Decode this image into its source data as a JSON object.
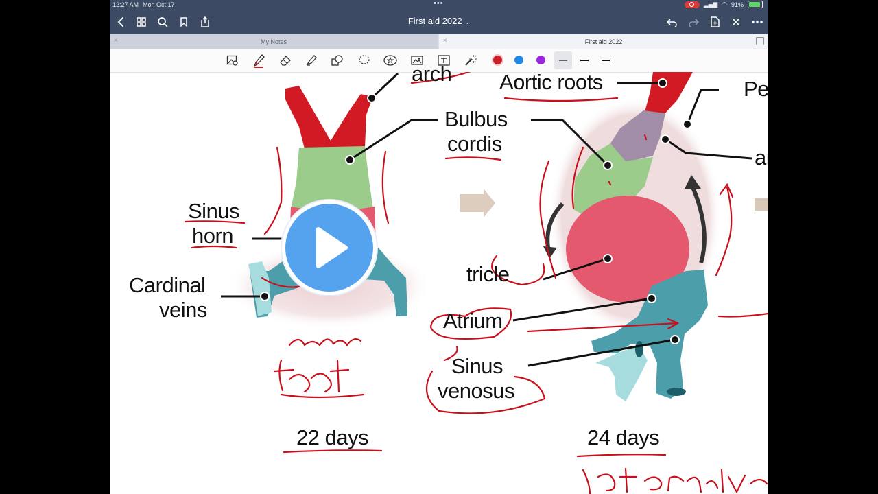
{
  "status": {
    "time": "12:27 AM",
    "date": "Mon Oct 17",
    "battery": "91%"
  },
  "nav": {
    "title": "First aid 2022"
  },
  "tabs": [
    {
      "label": "My Notes"
    },
    {
      "label": "First aid 2022"
    }
  ],
  "toolbar": {
    "colors": [
      "#cc1f2a",
      "#1e88e5",
      "#9c27e0"
    ]
  },
  "diagram": {
    "labels": {
      "arch": "arch",
      "aortic_roots": "Aortic roots",
      "pe": "Pe",
      "ar": "ar",
      "bulbus": "Bulbus",
      "cordis": "cordis",
      "sinus_horn_1": "Sinus",
      "sinus_horn_2": "horn",
      "cardinal_1": "Cardinal",
      "cardinal_2": "veins",
      "ventricle": "tricle",
      "atrium": "Atrium",
      "sinus_venosus_1": "Sinus",
      "sinus_venosus_2": "venosus",
      "days_22": "22 days",
      "days_24": "24 days"
    }
  },
  "colors": {
    "accent": "#3c4a64",
    "annotation": "#c8101c",
    "play": "#55a3ef"
  }
}
